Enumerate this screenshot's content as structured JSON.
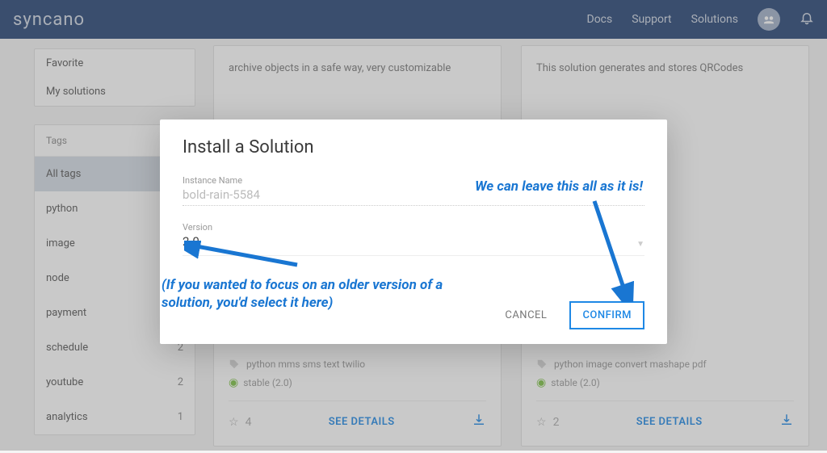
{
  "nav": {
    "logo": "syncano",
    "links": [
      "Docs",
      "Support",
      "Solutions"
    ]
  },
  "sidebar": {
    "favorites_label": "Favorite",
    "mysolutions_label": "My solutions",
    "tags_header": "Tags",
    "tags": [
      {
        "label": "All tags",
        "count": "",
        "active": true
      },
      {
        "label": "python",
        "count": ""
      },
      {
        "label": "image",
        "count": ""
      },
      {
        "label": "node",
        "count": ""
      },
      {
        "label": "payment",
        "count": ""
      },
      {
        "label": "schedule",
        "count": "2"
      },
      {
        "label": "youtube",
        "count": "2"
      },
      {
        "label": "analytics",
        "count": "1"
      }
    ]
  },
  "cards": [
    {
      "desc": "archive objects in a safe way, very customizable",
      "tagline": "python mms sms text twilio",
      "stable": "stable (2.0)",
      "stars": "4",
      "details": "SEE DETAILS"
    },
    {
      "desc": "This solution generates and stores QRCodes",
      "tagline": "python image convert mashape pdf",
      "stable": "stable (2.0)",
      "stars": "2",
      "details": "SEE DETAILS"
    }
  ],
  "modal": {
    "title": "Install a Solution",
    "instance_label": "Instance Name",
    "instance_value": "bold-rain-5584",
    "version_label": "Version",
    "version_value": "2.0",
    "cancel": "CANCEL",
    "confirm": "CONFIRM"
  },
  "annotations": {
    "a1": "We can leave this all as it is!",
    "a2": "(If you wanted to focus on an older version of a solution, you'd select it here)"
  }
}
